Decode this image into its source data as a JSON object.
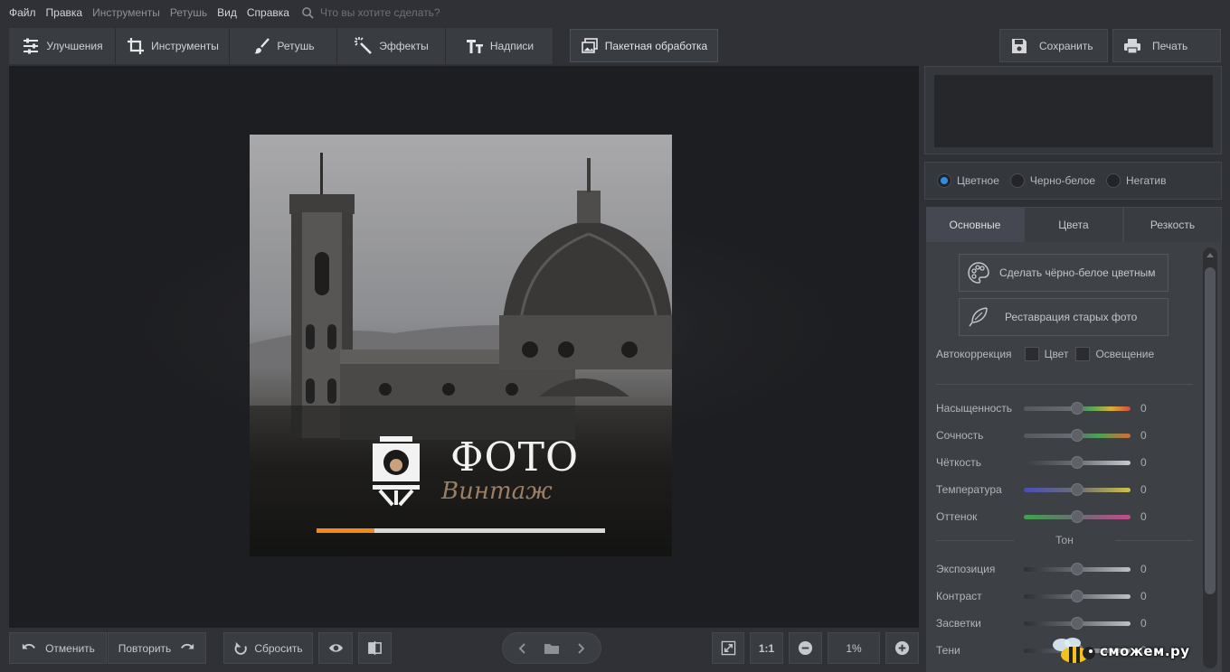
{
  "menu": {
    "items": [
      "Файл",
      "Правка",
      "Инструменты",
      "Ретушь",
      "Вид",
      "Справка"
    ],
    "search_placeholder": "Что вы хотите сделать?"
  },
  "toolbar": {
    "tabs": [
      {
        "label": "Улучшения",
        "icon": "sliders-icon"
      },
      {
        "label": "Инструменты",
        "icon": "crop-icon"
      },
      {
        "label": "Ретушь",
        "icon": "brush-icon"
      },
      {
        "label": "Эффекты",
        "icon": "magic-wand-icon"
      },
      {
        "label": "Надписи",
        "icon": "text-icon"
      }
    ],
    "batch_label": "Пакетная обработка",
    "save_label": "Сохранить",
    "print_label": "Печать"
  },
  "splash": {
    "logo_title": "ФОТО",
    "logo_subtitle": "Винтаж",
    "progress": 0.2,
    "colors": {
      "progress": "#f08a1c",
      "track": "#d9d9d9",
      "subtitle": "#9b7f63"
    }
  },
  "bottom": {
    "undo_label": "Отменить",
    "redo_label": "Повторить",
    "reset_label": "Сбросить",
    "ratio_label": "1:1",
    "zoom_value": "1%"
  },
  "side": {
    "modes": [
      {
        "label": "Цветное",
        "selected": true
      },
      {
        "label": "Черно-белое",
        "selected": false
      },
      {
        "label": "Негатив",
        "selected": false
      }
    ],
    "tabs": [
      "Основные",
      "Цвета",
      "Резкость"
    ],
    "active_tab": 0,
    "buttons": {
      "colorize": "Сделать чёрно-белое цветным",
      "restore": "Реставрация старых фото"
    },
    "autocorrection": {
      "label": "Автокоррекция",
      "color": "Цвет",
      "light": "Освещение"
    },
    "sliders": [
      {
        "label": "Насыщенность",
        "value": "0"
      },
      {
        "label": "Сочность",
        "value": "0"
      },
      {
        "label": "Чёткость",
        "value": "0"
      },
      {
        "label": "Температура",
        "value": "0"
      },
      {
        "label": "Оттенок",
        "value": "0"
      }
    ],
    "tone_header": "Тон",
    "tone_sliders": [
      {
        "label": "Экспозиция",
        "value": "0"
      },
      {
        "label": "Контраст",
        "value": "0"
      },
      {
        "label": "Засветки",
        "value": "0"
      },
      {
        "label": "Тени",
        "value": "0"
      }
    ],
    "accent": "#2f8de4"
  },
  "watermark": "сможем.ру"
}
